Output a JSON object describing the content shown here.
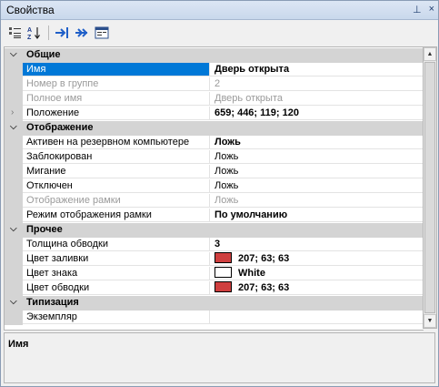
{
  "window": {
    "title": "Свойства",
    "pin_glyph": "⊥",
    "close_glyph": "×"
  },
  "toolbar": {
    "icons": [
      "categorized-icon",
      "sort-az-icon",
      "collapse-all-icon",
      "expand-all-icon",
      "property-pages-icon"
    ]
  },
  "categories": [
    {
      "label": "Общие",
      "rows": [
        {
          "name": "Имя",
          "value": "Дверь открыта",
          "state": "selected"
        },
        {
          "name": "Номер в группе",
          "value": "2",
          "state": "disabled"
        },
        {
          "name": "Полное имя",
          "value": "Дверь открыта",
          "state": "disabled"
        },
        {
          "name": "Положение",
          "value": "659; 446; 119; 120",
          "state": "collapsed"
        }
      ]
    },
    {
      "label": "Отображение",
      "rows": [
        {
          "name": "Активен на резервном компьютере",
          "value": "Ложь",
          "state": "bold"
        },
        {
          "name": "Заблокирован",
          "value": "Ложь",
          "state": "normal"
        },
        {
          "name": "Мигание",
          "value": "Ложь",
          "state": "normal"
        },
        {
          "name": "Отключен",
          "value": "Ложь",
          "state": "normal"
        },
        {
          "name": "Отображение рамки",
          "value": "Ложь",
          "state": "disabled"
        },
        {
          "name": "Режим отображения рамки",
          "value": "По умолчанию",
          "state": "bold"
        }
      ]
    },
    {
      "label": "Прочее",
      "rows": [
        {
          "name": "Толщина обводки",
          "value": "3",
          "state": "bold"
        },
        {
          "name": "Цвет заливки",
          "value": "207; 63; 63",
          "swatch": "#cf3f3f",
          "state": "bold"
        },
        {
          "name": "Цвет знака",
          "value": "White",
          "swatch": "#ffffff",
          "state": "bold"
        },
        {
          "name": "Цвет обводки",
          "value": "207; 63; 63",
          "swatch": "#cf3f3f",
          "state": "bold"
        }
      ]
    },
    {
      "label": "Типизация",
      "rows": [
        {
          "name": "Экземпляр",
          "value": "",
          "state": "normal"
        }
      ]
    }
  ],
  "description": {
    "title": "Имя"
  },
  "colors": {
    "selection": "#0078d7",
    "category_bg": "#d4d4d4"
  }
}
